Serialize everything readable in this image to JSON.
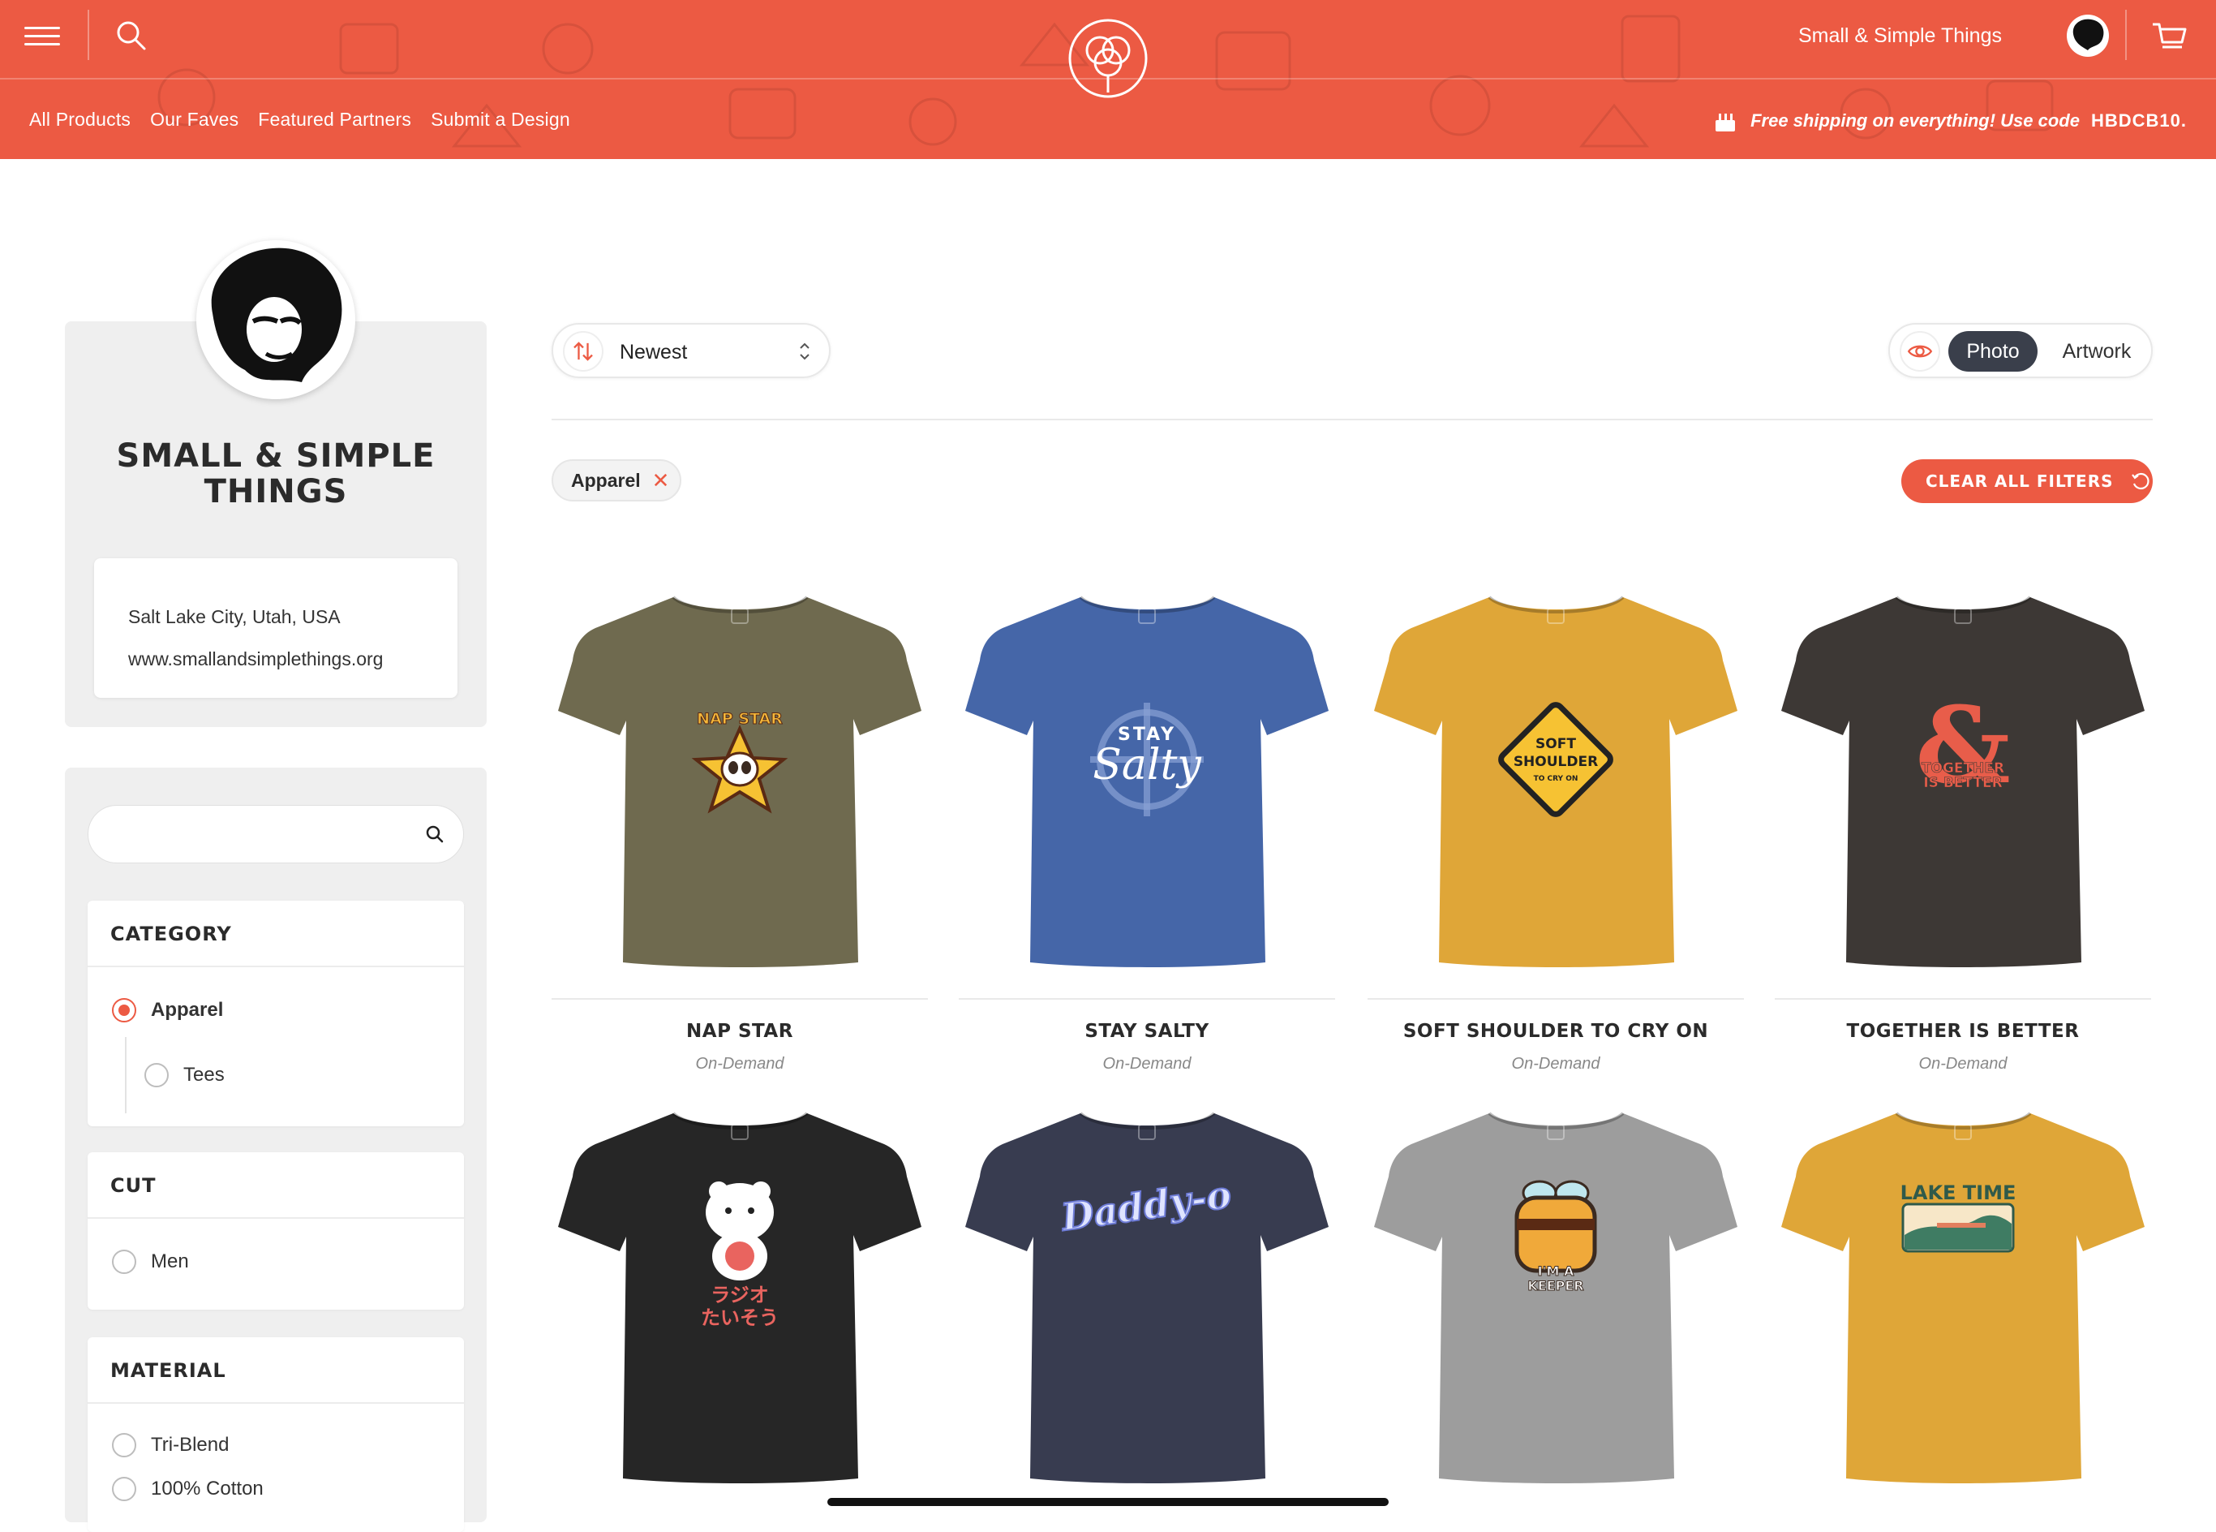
{
  "header": {
    "user_name": "Small & Simple Things",
    "nav": [
      "All Products",
      "Our Faves",
      "Featured Partners",
      "Submit a Design"
    ],
    "promo_text": "Free shipping on everything! Use code",
    "promo_code": "HBDCB10.",
    "brand_color": "#ec5a43"
  },
  "profile": {
    "name": "SMALL & SIMPLE THINGS",
    "location": "Salt Lake City, Utah, USA",
    "website": "www.smallandsimplethings.org"
  },
  "filters": {
    "search_placeholder": "",
    "category": {
      "title": "CATEGORY",
      "options": [
        {
          "label": "Apparel",
          "selected": true
        },
        {
          "label": "Tees",
          "selected": false
        }
      ]
    },
    "cut": {
      "title": "CUT",
      "options": [
        {
          "label": "Men",
          "selected": false
        }
      ]
    },
    "material": {
      "title": "MATERIAL",
      "options": [
        {
          "label": "Tri-Blend",
          "selected": false
        },
        {
          "label": "100% Cotton",
          "selected": false
        }
      ]
    }
  },
  "toolbar": {
    "sort_label": "Newest",
    "view_photo": "Photo",
    "view_artwork": "Artwork",
    "active_filter": "Apparel",
    "clear_all": "CLEAR ALL FILTERS"
  },
  "products": [
    {
      "title": "NAP STAR",
      "subtitle": "On-Demand",
      "shirt_color": "#6f6a4f",
      "art": "nap-star"
    },
    {
      "title": "STAY SALTY",
      "subtitle": "On-Demand",
      "shirt_color": "#4566a8",
      "art": "stay-salty"
    },
    {
      "title": "SOFT SHOULDER TO CRY ON",
      "subtitle": "On-Demand",
      "shirt_color": "#dfa638",
      "art": "soft-shoulder"
    },
    {
      "title": "TOGETHER IS BETTER",
      "subtitle": "On-Demand",
      "shirt_color": "#3d3835",
      "art": "together"
    },
    {
      "title": "",
      "subtitle": "",
      "shirt_color": "#262626",
      "art": "bear"
    },
    {
      "title": "",
      "subtitle": "",
      "shirt_color": "#383c50",
      "art": "daddy-o"
    },
    {
      "title": "",
      "subtitle": "",
      "shirt_color": "#9d9d9d",
      "art": "keeper"
    },
    {
      "title": "",
      "subtitle": "",
      "shirt_color": "#dfa638",
      "art": "lake-time"
    }
  ],
  "art_text": {
    "nap_star": "NAP STAR",
    "stay": "STAY",
    "salty": "Salty",
    "soft": "SOFT",
    "shoulder": "SHOULDER",
    "to_cry_on": "TO CRY ON",
    "together": "TOGETHER",
    "is_better": "IS BETTER",
    "radio_jp": "ラジオ",
    "taiso_jp": "たいそう",
    "daddy": "Daddy-o",
    "im_a": "I'M A",
    "keeper": "KEEPER",
    "lake_time": "LAKE TIME"
  }
}
